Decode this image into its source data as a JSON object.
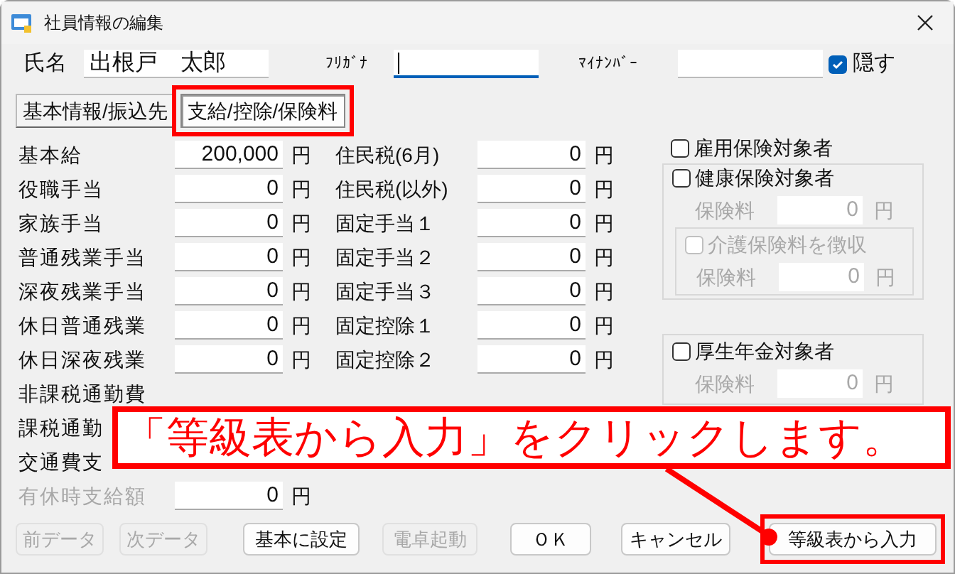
{
  "window": {
    "title": "社員情報の編集"
  },
  "header": {
    "name": {
      "label": "氏名",
      "value": "出根戸　太郎"
    },
    "furigana": {
      "label": "ﾌﾘｶﾞﾅ",
      "focused": true
    },
    "mynumber": {
      "label": "ﾏｲﾅﾝﾊﾞｰ"
    },
    "hide": {
      "label": "隠す",
      "checked": true
    }
  },
  "tabs": [
    {
      "label": "基本情報/振込先",
      "selected": false,
      "highlighted": false
    },
    {
      "label": "支給/控除/保険料",
      "selected": true,
      "highlighted": true
    }
  ],
  "pay_items": [
    {
      "label": "基本給",
      "value": "200,000",
      "unit": "円",
      "disabled": false
    },
    {
      "label": "役職手当",
      "value": "0",
      "unit": "円",
      "disabled": false
    },
    {
      "label": "家族手当",
      "value": "0",
      "unit": "円",
      "disabled": false
    },
    {
      "label": "普通残業手当",
      "value": "0",
      "unit": "円",
      "disabled": false
    },
    {
      "label": "深夜残業手当",
      "value": "0",
      "unit": "円",
      "disabled": false
    },
    {
      "label": "休日普通残業",
      "value": "0",
      "unit": "円",
      "disabled": false
    },
    {
      "label": "休日深夜残業",
      "value": "0",
      "unit": "円",
      "disabled": false
    },
    {
      "label": "非課税通勤費",
      "disabled": false
    },
    {
      "label": "課税通勤",
      "disabled": false
    },
    {
      "label": "交通費支",
      "disabled": false
    },
    {
      "label": "有休時支給額",
      "value": "0",
      "unit": "円",
      "disabled": true
    }
  ],
  "deduction_items": [
    {
      "label": "住民税(6月)",
      "value": "0",
      "unit": "円"
    },
    {
      "label": "住民税(以外)",
      "value": "0",
      "unit": "円"
    },
    {
      "label": "固定手当１",
      "value": "0",
      "unit": "円"
    },
    {
      "label": "固定手当２",
      "value": "0",
      "unit": "円"
    },
    {
      "label": "固定手当３",
      "value": "0",
      "unit": "円"
    },
    {
      "label": "固定控除１",
      "value": "0",
      "unit": "円"
    },
    {
      "label": "固定控除２",
      "value": "0",
      "unit": "円"
    }
  ],
  "insurance": {
    "employment": {
      "label": "雇用保険対象者",
      "checked": false
    },
    "health": {
      "label": "健康保険対象者",
      "checked": false,
      "premium_label": "保険料",
      "premium": "0",
      "unit": "円",
      "care": {
        "label": "介護保険料を徴収",
        "checked": false,
        "disabled": true,
        "premium_label": "保険料",
        "premium": "0",
        "unit": "円"
      }
    },
    "pension": {
      "label": "厚生年金対象者",
      "checked": false,
      "premium_label": "保険料",
      "premium": "0",
      "unit": "円"
    }
  },
  "buttons": [
    {
      "label": "前データ",
      "disabled": true,
      "highlighted": false
    },
    {
      "label": "次データ",
      "disabled": true,
      "highlighted": false
    },
    {
      "label": "基本に設定",
      "disabled": false,
      "highlighted": false
    },
    {
      "label": "電卓起動",
      "disabled": true,
      "highlighted": false
    },
    {
      "label": "ＯＫ",
      "disabled": false,
      "highlighted": false
    },
    {
      "label": "キャンセル",
      "disabled": false,
      "highlighted": false
    },
    {
      "label": "等級表から入力",
      "disabled": false,
      "highlighted": true
    }
  ],
  "callout": {
    "text": "「等級表から入力」をクリックします。"
  }
}
